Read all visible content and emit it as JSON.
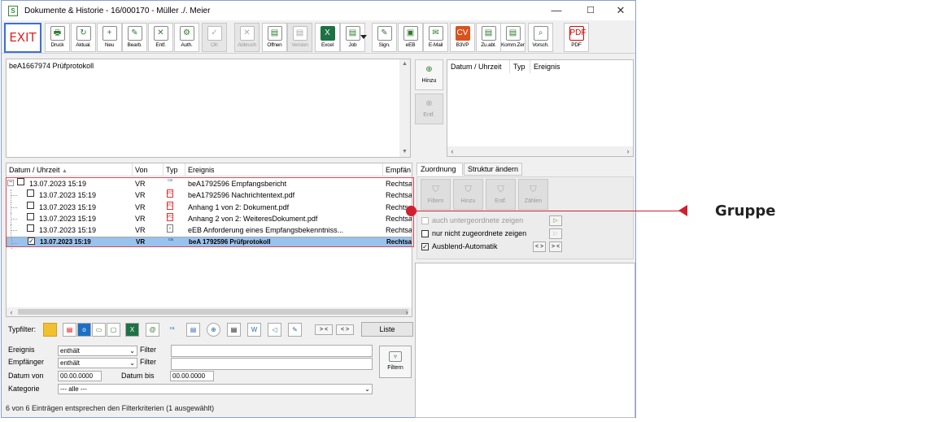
{
  "window": {
    "title": "Dokumente & Historie - 16/000170 - Müller ./. Meier",
    "app_icon": "S",
    "controls": {
      "minimize": "—",
      "maximize": "☐",
      "close": "✕"
    }
  },
  "toolbar": {
    "exit_label": "EXIT",
    "buttons": [
      {
        "label": "Druck",
        "icon": "🖶",
        "disabled": false
      },
      {
        "label": "Aktual.",
        "icon": "↻",
        "disabled": false
      },
      {
        "label": "Neu",
        "icon": "+",
        "disabled": false
      },
      {
        "label": "Bearb.",
        "icon": "✎",
        "disabled": false
      },
      {
        "label": "Entf.",
        "icon": "✕",
        "disabled": false
      },
      {
        "label": "Auth.",
        "icon": "⚙",
        "disabled": false
      },
      {
        "label": "OK",
        "icon": "✓",
        "disabled": true
      },
      {
        "label": "Abbruch",
        "icon": "✕",
        "disabled": true
      },
      {
        "label": "Öffnen",
        "icon": "▤",
        "disabled": false
      },
      {
        "label": "Version",
        "icon": "▤",
        "disabled": true
      },
      {
        "label": "Excel",
        "icon": "X",
        "disabled": false
      },
      {
        "label": "Job",
        "icon": "▤",
        "disabled": false
      },
      {
        "label": "Sign.",
        "icon": "✎",
        "disabled": false
      },
      {
        "label": "eEB",
        "icon": "▣",
        "disabled": false
      },
      {
        "label": "E-Mail",
        "icon": "✉",
        "disabled": false
      },
      {
        "label": "B3VP",
        "icon": "CV",
        "disabled": false
      },
      {
        "label": "Zu.abl.",
        "icon": "▤",
        "disabled": false
      },
      {
        "label": "Komm.Zen.",
        "icon": "▤",
        "disabled": false
      },
      {
        "label": "Vorsch.",
        "icon": "⌕",
        "disabled": false
      },
      {
        "label": "PDF",
        "icon": "PDF",
        "disabled": false
      }
    ]
  },
  "note": {
    "text": "beA1667974 Prüfprotokoll"
  },
  "side_buttons": {
    "add": "Hinzu",
    "remove": "Entf."
  },
  "events_table": {
    "headers": [
      "Datum / Uhrzeit",
      "Typ",
      "Ereignis"
    ]
  },
  "grid": {
    "headers": [
      "Datum / Uhrzeit",
      "Von",
      "Typ",
      "Ereignis",
      "Empfän"
    ],
    "sort_indicator": "▲",
    "rows": [
      {
        "date": "13.07.2023 15:19",
        "von": "VR",
        "typ": "bea",
        "event": "beA1792596 Empfangsbericht",
        "recv": "Rechtsa",
        "level": 0,
        "checked": false,
        "selected": false
      },
      {
        "date": "13.07.2023 15:19",
        "von": "VR",
        "typ": "pdf",
        "event": "beA1792596 Nachrichtentext.pdf",
        "recv": "Rechtsa",
        "level": 1,
        "checked": false,
        "selected": false
      },
      {
        "date": "13.07.2023 15:19",
        "von": "VR",
        "typ": "pdf",
        "event": "Anhang 1 von 2: Dokument.pdf",
        "recv": "Rechtsa",
        "level": 1,
        "checked": false,
        "selected": false
      },
      {
        "date": "13.07.2023 15:19",
        "von": "VR",
        "typ": "pdf",
        "event": "Anhang 2 von 2: WeiteresDokument.pdf",
        "recv": "Rechtsa",
        "level": 1,
        "checked": false,
        "selected": false
      },
      {
        "date": "13.07.2023 15:19",
        "von": "VR",
        "typ": "doc",
        "event": "eEB Anforderung eines Empfangsbekenntniss...",
        "recv": "Rechtsa",
        "level": 1,
        "checked": false,
        "selected": false
      },
      {
        "date": "13.07.2023 15:19",
        "von": "VR",
        "typ": "bea",
        "event": "beA 1792596 Prüfprotokoll",
        "recv": "Rechtsa",
        "level": 1,
        "checked": true,
        "selected": true
      }
    ]
  },
  "typfilter": {
    "label": "Typfilter:",
    "nav_prev": "> <",
    "nav_next": "< >",
    "list_button": "Liste"
  },
  "filters": {
    "ereignis_label": "Ereignis",
    "ereignis_op": "enthält",
    "empfaenger_label": "Empfänger",
    "empfaenger_op": "enthält",
    "filter_label": "Filter",
    "datum_von_label": "Datum von",
    "datum_von": "00.00.0000",
    "datum_bis_label": "Datum bis",
    "datum_bis": "00.00.0000",
    "kategorie_label": "Kategorie",
    "kategorie_value": "--- alle ---",
    "filter_button": "Filtern"
  },
  "status_text": "6 von 6 Einträgen entsprechen den Filterkriterien (1 ausgewählt)",
  "tabs": [
    "Zuordnung",
    "Struktur ändern"
  ],
  "assign_buttons": [
    "Filtern",
    "Hinzu",
    "Entf.",
    "Zählen"
  ],
  "options": {
    "sub_items": "auch untergeordnete zeigen",
    "unassigned": "nur nicht zugeordnete zeigen",
    "auto_hide": "Ausblend-Automatik",
    "btn_expand": "< >",
    "btn_collapse": "> <"
  },
  "callout": {
    "label": "Gruppe"
  },
  "colors": {
    "accent": "#d0202f",
    "selection": "#99c2ed",
    "exit_text": "#dd2222"
  }
}
